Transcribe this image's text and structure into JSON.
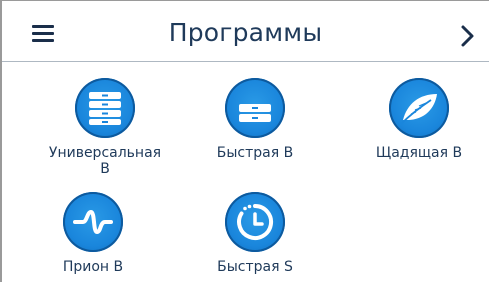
{
  "header": {
    "title": "Программы",
    "menu_icon": "hamburger-menu-icon",
    "next_icon": "chevron-right-icon"
  },
  "programs": [
    {
      "label_line1": "Универсальная",
      "label_line2": "B",
      "icon": "stacked-trays-icon"
    },
    {
      "label_line1": "Быстрая B",
      "label_line2": "",
      "icon": "double-tray-icon"
    },
    {
      "label_line1": "Щадящая B",
      "label_line2": "",
      "icon": "feather-icon"
    },
    {
      "label_line1": "Прион B",
      "label_line2": "",
      "icon": "prion-wave-icon"
    },
    {
      "label_line1": "Быстрая S",
      "label_line2": "",
      "icon": "timer-icon"
    }
  ],
  "colors": {
    "accent": "#1a86dc",
    "text": "#1f3a5a",
    "divider": "#aeb8c2"
  }
}
